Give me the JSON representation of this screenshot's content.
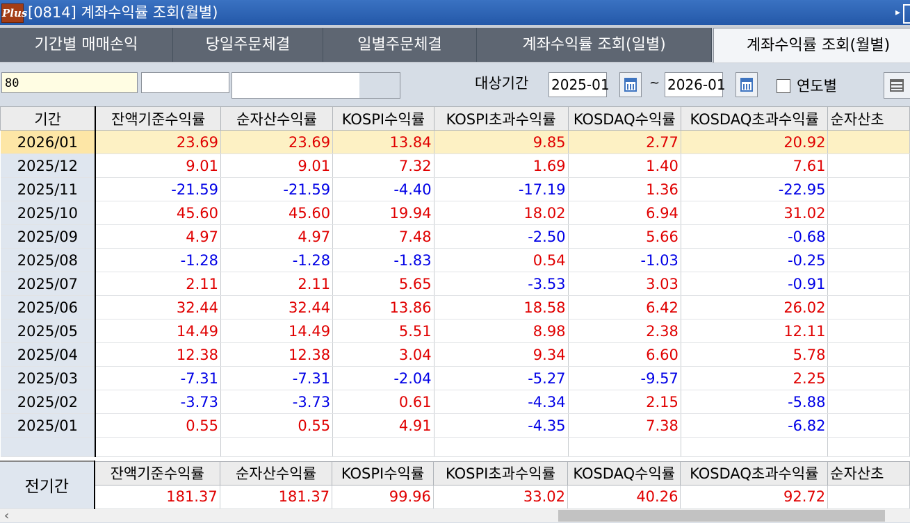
{
  "window": {
    "logo_text": "Plus",
    "title": "[0814] 계좌수익률 조회(월별)"
  },
  "tabs": [
    {
      "label": "기간별 매매손익",
      "active": false
    },
    {
      "label": "당일주문체결",
      "active": false
    },
    {
      "label": "일별주문체결",
      "active": false
    },
    {
      "label": "계좌수익률 조회(일별)",
      "active": false
    },
    {
      "label": "계좌수익률 조회(월별)",
      "active": true
    }
  ],
  "toolbar": {
    "account_value": "80",
    "period_label": "대상기간",
    "start_date": "2025-01",
    "tilde": "~",
    "end_date": "2026-01",
    "yearly_label": "연도별"
  },
  "table": {
    "headers": [
      "기간",
      "잔액기준수익률",
      "순자산수익률",
      "KOSPI수익률",
      "KOSPI초과수익률",
      "KOSDAQ수익률",
      "KOSDAQ초과수익률",
      "순자산초"
    ],
    "rows": [
      {
        "period": "2026/01",
        "values": [
          "23.69",
          "23.69",
          "13.84",
          "9.85",
          "2.77",
          "20.92"
        ],
        "selected": true
      },
      {
        "period": "2025/12",
        "values": [
          "9.01",
          "9.01",
          "7.32",
          "1.69",
          "1.40",
          "7.61"
        ]
      },
      {
        "period": "2025/11",
        "values": [
          "-21.59",
          "-21.59",
          "-4.40",
          "-17.19",
          "1.36",
          "-22.95"
        ]
      },
      {
        "period": "2025/10",
        "values": [
          "45.60",
          "45.60",
          "19.94",
          "18.02",
          "6.94",
          "31.02"
        ]
      },
      {
        "period": "2025/09",
        "values": [
          "4.97",
          "4.97",
          "7.48",
          "-2.50",
          "5.66",
          "-0.68"
        ]
      },
      {
        "period": "2025/08",
        "values": [
          "-1.28",
          "-1.28",
          "-1.83",
          "0.54",
          "-1.03",
          "-0.25"
        ]
      },
      {
        "period": "2025/07",
        "values": [
          "2.11",
          "2.11",
          "5.65",
          "-3.53",
          "3.03",
          "-0.91"
        ]
      },
      {
        "period": "2025/06",
        "values": [
          "32.44",
          "32.44",
          "13.86",
          "18.58",
          "6.42",
          "26.02"
        ]
      },
      {
        "period": "2025/05",
        "values": [
          "14.49",
          "14.49",
          "5.51",
          "8.98",
          "2.38",
          "12.11"
        ]
      },
      {
        "period": "2025/04",
        "values": [
          "12.38",
          "12.38",
          "3.04",
          "9.34",
          "6.60",
          "5.78"
        ]
      },
      {
        "period": "2025/03",
        "values": [
          "-7.31",
          "-7.31",
          "-2.04",
          "-5.27",
          "-9.57",
          "2.25"
        ]
      },
      {
        "period": "2025/02",
        "values": [
          "-3.73",
          "-3.73",
          "0.61",
          "-4.34",
          "2.15",
          "-5.88"
        ]
      },
      {
        "period": "2025/01",
        "values": [
          "0.55",
          "0.55",
          "4.91",
          "-4.35",
          "7.38",
          "-6.82"
        ]
      }
    ]
  },
  "summary": {
    "label": "전기간",
    "headers": [
      "잔액기준수익률",
      "순자산수익률",
      "KOSPI수익률",
      "KOSPI초과수익률",
      "KOSDAQ수익률",
      "KOSDAQ초과수익률",
      "순자산초"
    ],
    "values": [
      "181.37",
      "181.37",
      "99.96",
      "33.02",
      "40.26",
      "92.72"
    ]
  },
  "colors": {
    "positive": "#e00000",
    "negative": "#0000e6",
    "selected_row": "#fdf1c4"
  }
}
